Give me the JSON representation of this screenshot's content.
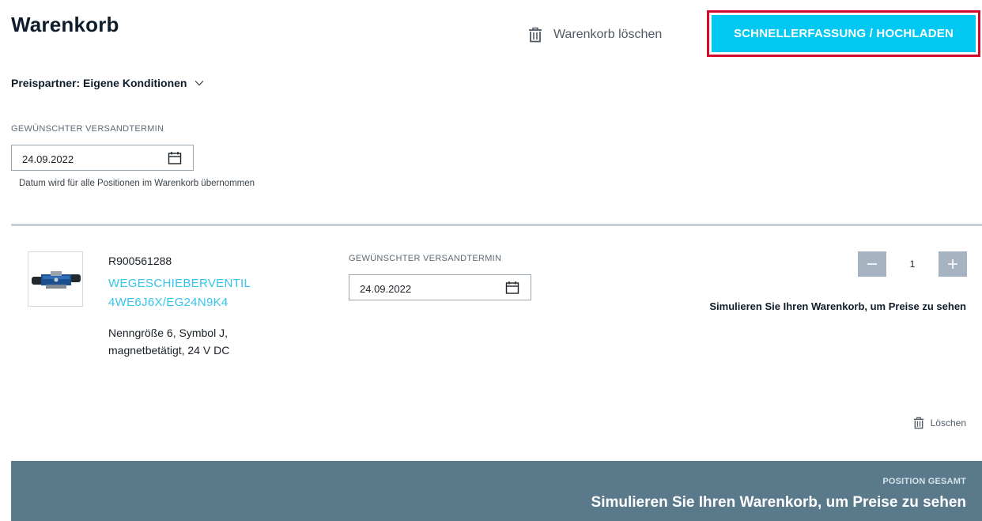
{
  "header": {
    "title": "Warenkorb",
    "clear_cart_label": "Warenkorb löschen",
    "quick_entry_label": "SCHNELLERFASSUNG / HOCHLADEN"
  },
  "price_partner": {
    "label": "Preispartner: Eigene Konditionen"
  },
  "global_shipping": {
    "label": "GEWÜNSCHTER VERSANDTERMIN",
    "date": "24.09.2022",
    "hint": "Datum wird für alle Positionen im Warenkorb übernommen"
  },
  "items": [
    {
      "number": "R900561288",
      "name": "WEGESCHIEBERVENTIL 4WE6J6X/EG24N9K4",
      "description": "Nenngröße 6, Symbol J, magnetbetätigt, 24 V DC",
      "shipping_label": "GEWÜNSCHTER VERSANDTERMIN",
      "shipping_date": "24.09.2022",
      "quantity": "1",
      "price_message": "Simulieren Sie Ihren Warenkorb, um Preise zu sehen",
      "delete_label": "Löschen"
    }
  ],
  "footer": {
    "subtitle": "POSITION GESAMT",
    "message": "Simulieren Sie Ihren Warenkorb, um Preise zu sehen"
  },
  "colors": {
    "accent": "#00c8f2",
    "focus_border": "#d40a2c",
    "footer_bg": "#5a7a8c",
    "link": "#35c4ea",
    "stepper": "#a5b4c0"
  }
}
